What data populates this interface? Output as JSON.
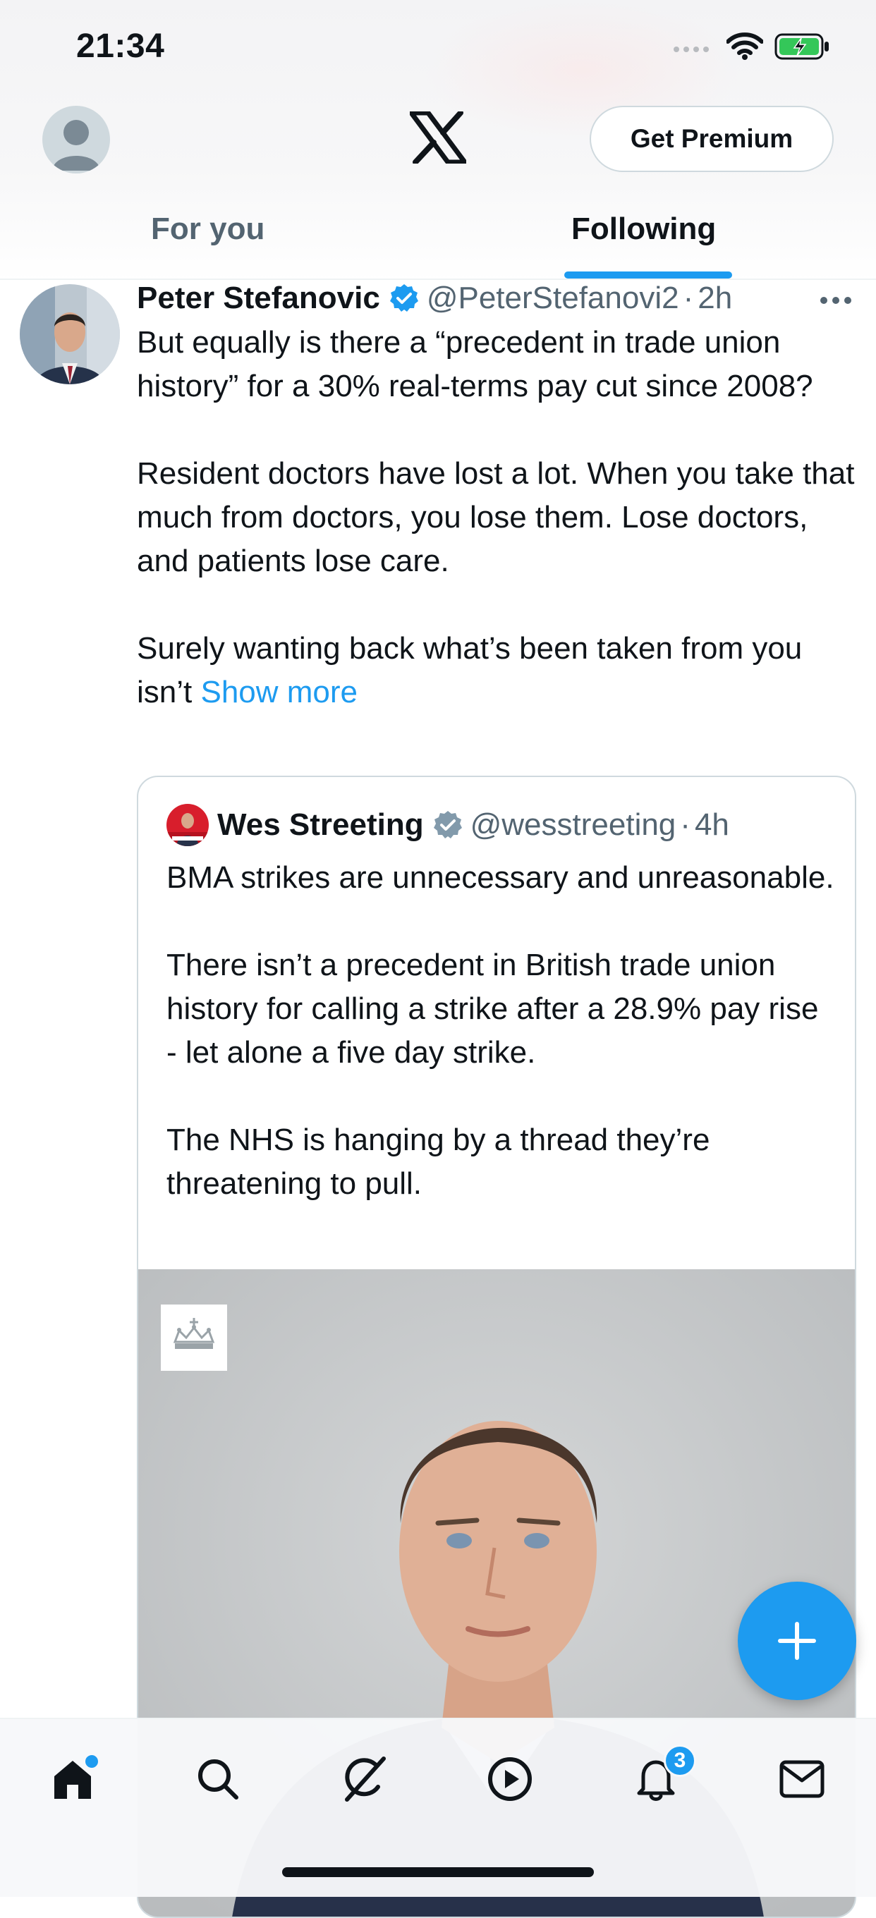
{
  "status_bar": {
    "time": "21:34"
  },
  "header": {
    "premium_label": "Get Premium",
    "tabs": [
      {
        "label": "For you",
        "selected": false
      },
      {
        "label": "Following",
        "selected": true
      }
    ]
  },
  "tweet": {
    "author_name": "Peter Stefanovic",
    "handle": "@PeterStefanovi2",
    "separator": "·",
    "time": "2h",
    "paragraphs": [
      "But equally is there a “precedent in trade union history” for a 30% real-terms pay cut since 2008?",
      "Resident doctors have lost a lot. When you take that much from doctors, you lose them. Lose doctors, and patients lose care.",
      "Surely wanting back what’s been taken from you isn’t"
    ],
    "show_more": "Show more",
    "quote": {
      "author_name": "Wes Streeting",
      "handle": "@wesstreeting",
      "separator": "·",
      "time": "4h",
      "paragraphs": [
        "BMA strikes are unnecessary and unreasonable.",
        "There isn’t a precedent in British trade union history for calling a strike after a 28.9% pay rise - let alone a five day strike.",
        "The NHS is hanging by a thread they’re threatening to pull."
      ]
    }
  },
  "bottom_nav": {
    "items": [
      "home-icon",
      "search-icon",
      "grok-icon",
      "video-icon",
      "notifications-icon",
      "messages-icon"
    ],
    "notifications_badge": "3"
  },
  "colors": {
    "accent": "#1d9bf0",
    "text": "#0f1419",
    "secondary": "#536471",
    "border": "#cfd9de"
  }
}
